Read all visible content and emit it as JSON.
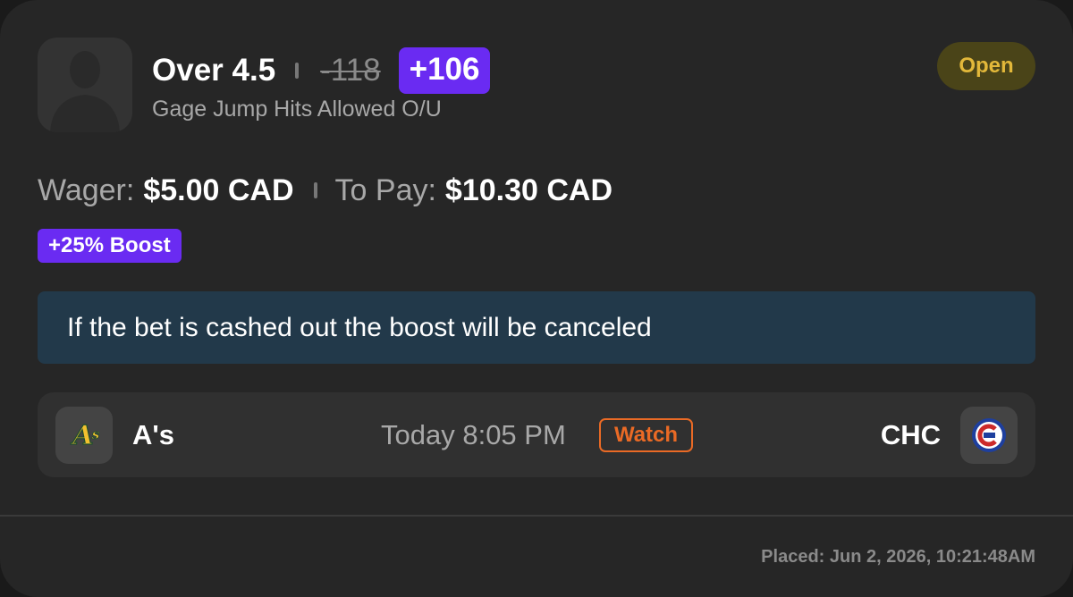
{
  "bet": {
    "selection": "Over 4.5",
    "old_odds": "-118",
    "boosted_odds": "+106",
    "market": "Gage Jump Hits Allowed O/U",
    "status": "Open",
    "player_icon": "person-silhouette-icon"
  },
  "payout": {
    "wager_label": "Wager:",
    "wager_value": "$5.00 CAD",
    "to_pay_label": "To Pay:",
    "to_pay_value": "$10.30 CAD"
  },
  "boost": {
    "label": "+25% Boost"
  },
  "notice": {
    "text": "If the bet is cashed out the boost will be canceled"
  },
  "game": {
    "away_team": "A's",
    "away_logo": "athletics-logo-icon",
    "time": "Today 8:05 PM",
    "watch_label": "Watch",
    "home_team": "CHC",
    "home_logo": "cubs-logo-icon"
  },
  "footer": {
    "placed": "Placed: Jun 2, 2026, 10:21:48AM"
  },
  "colors": {
    "card_background": "#262626",
    "boost_purple": "#6a2bf2",
    "status_text": "#e2b83a",
    "status_background": "#4a4418",
    "watch_orange": "#ea6a25",
    "notice_background": "#22394a"
  }
}
